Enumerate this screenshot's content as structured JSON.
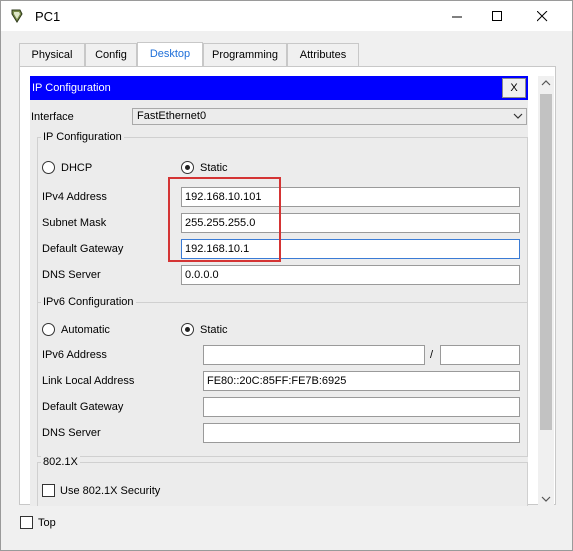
{
  "window": {
    "title": "PC1",
    "minimize_icon": "minimize-icon",
    "maximize_icon": "maximize-icon",
    "close_icon": "close-icon"
  },
  "tabs": [
    {
      "label": "Physical",
      "active": false
    },
    {
      "label": "Config",
      "active": false
    },
    {
      "label": "Desktop",
      "active": true
    },
    {
      "label": "Programming",
      "active": false
    },
    {
      "label": "Attributes",
      "active": false
    }
  ],
  "panel": {
    "header": "IP Configuration",
    "close_label": "X",
    "header_color": "#0000ff",
    "interface_label": "Interface",
    "interface_value": "FastEthernet0"
  },
  "ipv4": {
    "group_title": "IP Configuration",
    "dhcp_label": "DHCP",
    "static_label": "Static",
    "mode": "Static",
    "ip_label": "IPv4 Address",
    "ip_value": "192.168.10.101",
    "mask_label": "Subnet Mask",
    "mask_value": "255.255.255.0",
    "gateway_label": "Default Gateway",
    "gateway_value": "192.168.10.1",
    "dns_label": "DNS Server",
    "dns_value": "0.0.0.0"
  },
  "ipv6": {
    "group_title": "IPv6 Configuration",
    "automatic_label": "Automatic",
    "static_label": "Static",
    "mode": "Static",
    "address_label": "IPv6 Address",
    "address_value": "",
    "prefix_separator": "/",
    "prefix_value": "",
    "link_local_label": "Link Local Address",
    "link_local_value": "FE80::20C:85FF:FE7B:6925",
    "gateway_label": "Default Gateway",
    "gateway_value": "",
    "dns_label": "DNS Server",
    "dns_value": ""
  },
  "dot1x": {
    "group_title": "802.1X",
    "checkbox_label": "Use 802.1X Security",
    "checked": false
  },
  "footer": {
    "top_label": "Top",
    "top_checked": false
  },
  "highlight_color": "#d43434"
}
